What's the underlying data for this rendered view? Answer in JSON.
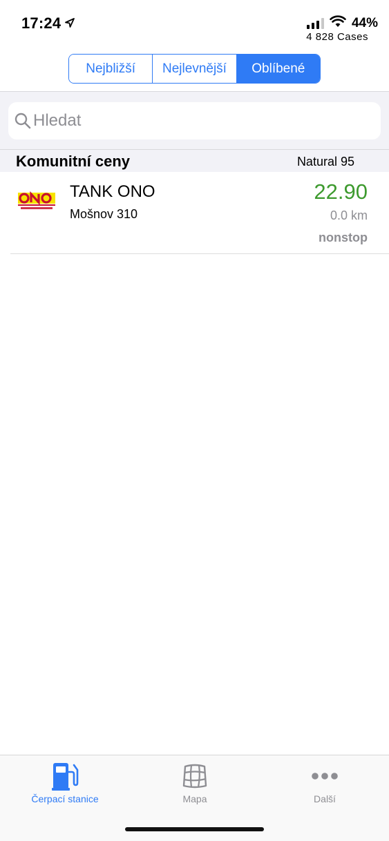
{
  "status_bar": {
    "time": "17:24",
    "battery": "44%",
    "cases": "4 828 Cases"
  },
  "segments": [
    {
      "label": "Nejbližší",
      "active": false
    },
    {
      "label": "Nejlevnější",
      "active": false
    },
    {
      "label": "Oblíbené",
      "active": true
    }
  ],
  "search": {
    "placeholder": "Hledat"
  },
  "section": {
    "title": "Komunitní ceny",
    "fuel_type": "Natural 95"
  },
  "stations": [
    {
      "name": "TANK ONO",
      "address": "Mošnov 310",
      "price": "22.90",
      "distance": "0.0 km",
      "hours": "nonstop",
      "logo_icon": "ono-logo",
      "price_color": "#3d9a2e"
    }
  ],
  "tab_bar": {
    "tabs": [
      {
        "label": "Čerpací stanice",
        "icon": "fuel-pump-icon",
        "active": true
      },
      {
        "label": "Mapa",
        "icon": "map-icon",
        "active": false
      },
      {
        "label": "Další",
        "icon": "more-dots-icon",
        "active": false
      }
    ]
  },
  "colors": {
    "accent": "#2f7bf5",
    "price_green": "#3d9a2e",
    "muted": "#8e8e93"
  }
}
